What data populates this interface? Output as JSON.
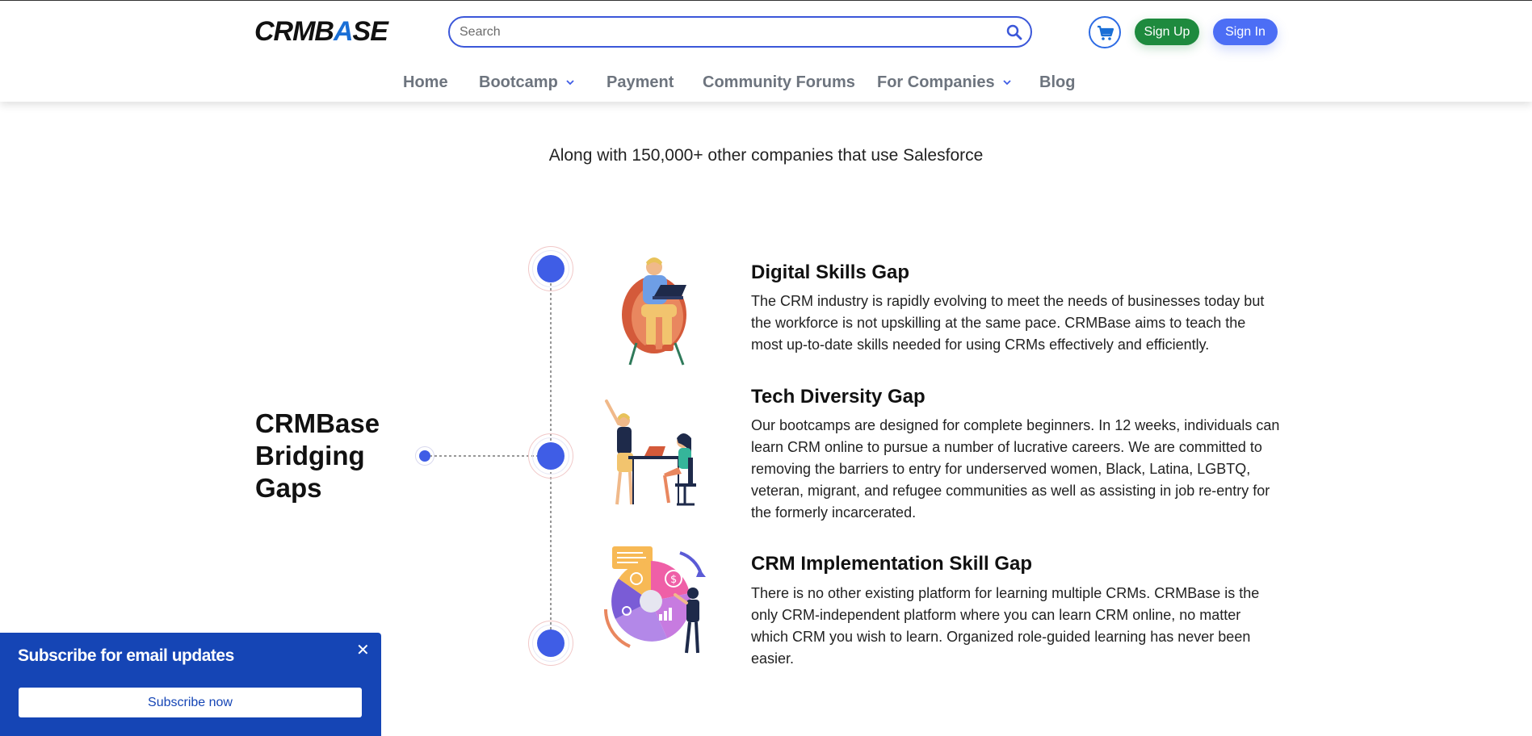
{
  "header": {
    "logo_text_1": "CRMB",
    "logo_text_2": "A",
    "logo_text_3": "SE",
    "search_placeholder": "Search",
    "cart_icon": "cart-icon",
    "signup_label": "Sign Up",
    "signin_label": "Sign In"
  },
  "nav": {
    "items": [
      {
        "label": "Home",
        "has_dropdown": false
      },
      {
        "label": "Bootcamp",
        "has_dropdown": true
      },
      {
        "label": "Payment",
        "has_dropdown": false
      },
      {
        "label": "Community Forums",
        "has_dropdown": false
      },
      {
        "label": "For Companies",
        "has_dropdown": true
      },
      {
        "label": "Blog",
        "has_dropdown": false
      }
    ]
  },
  "main": {
    "tagline": "Along with 150,000+ other companies that use Salesforce",
    "section_title": "CRMBase Bridging Gaps",
    "items": [
      {
        "title": "Digital Skills Gap",
        "description": "The CRM industry is rapidly evolving to meet the needs of businesses today but the workforce is not upskilling at the same pace. CRMBase aims to teach the most up-to-date skills needed for using CRMs effectively and efficiently."
      },
      {
        "title": "Tech Diversity Gap",
        "description": "Our bootcamps are designed for complete beginners. In 12 weeks, individuals can learn CRM online to pursue a number of lucrative careers. We are committed to removing the barriers to entry for underserved women, Black, Latina, LGBTQ, veteran, migrant, and refugee communities as well as assisting in job re-entry for the formerly incarcerated."
      },
      {
        "title": "CRM Implementation Skill Gap",
        "description": "There is no other existing platform for learning multiple CRMs. CRMBase is the only CRM-independent platform where you can learn CRM online, no matter which CRM you wish to learn. Organized role-guided learning has never been easier."
      }
    ]
  },
  "popup": {
    "title": "Subscribe for email updates",
    "close_glyph": "✕",
    "button_label": "Subscribe now"
  },
  "colors": {
    "primary_blue": "#3f5de6",
    "signup_green": "#1e8a3e",
    "signin_blue": "#4c6ef5",
    "popup_blue": "#1545b5",
    "nav_gray": "#6d747e"
  }
}
